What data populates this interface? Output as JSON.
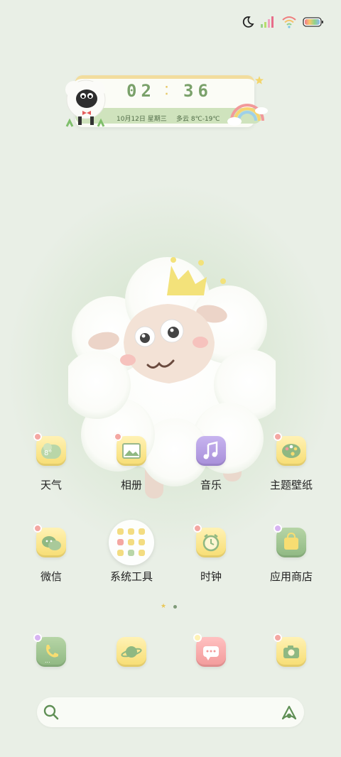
{
  "status_bar": {
    "icons": [
      "moon-icon",
      "signal-icon",
      "wifi-icon",
      "battery-icon"
    ]
  },
  "widget": {
    "hours": "02",
    "minutes": "36",
    "date": "10月12日 星期三",
    "weather": "多云 8℃-19℃",
    "icons": [
      "sheep-icon",
      "rainbow-icon"
    ]
  },
  "apps_row1": [
    {
      "label": "天气",
      "icon": "weather-icon",
      "color": "#f7dd72"
    },
    {
      "label": "相册",
      "icon": "gallery-icon",
      "color": "#f7dd72"
    },
    {
      "label": "音乐",
      "icon": "music-icon",
      "color": "#a78ed9"
    },
    {
      "label": "主题壁纸",
      "icon": "palette-icon",
      "color": "#f7dd72"
    }
  ],
  "apps_row2": [
    {
      "label": "微信",
      "icon": "wechat-icon",
      "color": "#f7dd72"
    },
    {
      "label": "系统工具",
      "icon": "folder-icon",
      "color": "#ffffff"
    },
    {
      "label": "时钟",
      "icon": "alarm-clock-icon",
      "color": "#f7dd72"
    },
    {
      "label": "应用商店",
      "icon": "store-bag-icon",
      "color": "#8fb882"
    }
  ],
  "dock": [
    {
      "icon": "phone-icon",
      "color": "#8fb882"
    },
    {
      "icon": "browser-planet-icon",
      "color": "#f7dd72"
    },
    {
      "icon": "messages-icon",
      "color": "#f29a9a"
    },
    {
      "icon": "camera-icon",
      "color": "#f7dd72"
    }
  ],
  "page_indicator": {
    "pages": 2,
    "current": 2
  },
  "search": {
    "icons": [
      "search-icon",
      "assistant-icon"
    ]
  }
}
